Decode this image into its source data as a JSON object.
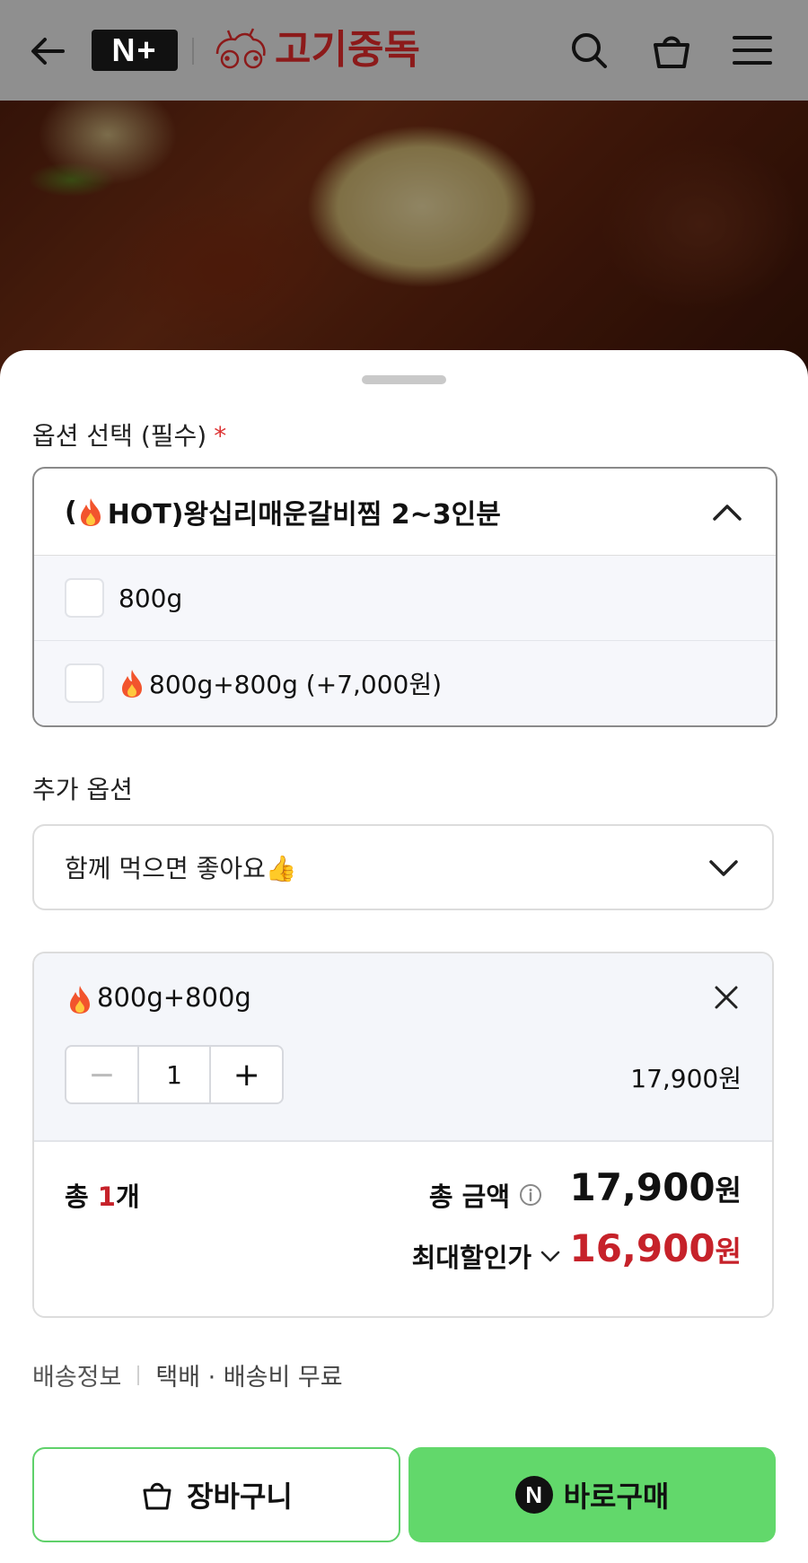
{
  "header": {
    "nplus_label": "N+",
    "brand_name": "고기중독",
    "icons": [
      "back-icon",
      "search-icon",
      "bag-icon",
      "menu-icon"
    ]
  },
  "options": {
    "required_label": "옵션 선택 (필수)",
    "required_mark": "*",
    "selected_title": "HOT)왕십리매운갈비찜 2~3인분",
    "selected_prefix": "(",
    "items": [
      {
        "label": "800g",
        "checked": false
      },
      {
        "label": "800g+800g (+7,000원)",
        "checked": false
      }
    ]
  },
  "extra": {
    "label": "추가 옵션",
    "placeholder": "함께 먹으면 좋아요👍"
  },
  "cart": {
    "item_name": "800g+800g",
    "quantity": "1",
    "minus_label": "−",
    "plus_label": "+",
    "line_price": "17,900원",
    "total_prefix": "총 ",
    "total_count": "1",
    "total_suffix": "개",
    "total_label": "총 금액",
    "total_amount": "17,900",
    "won": "원",
    "discount_label": "최대할인가",
    "discount_amount": "16,900"
  },
  "shipping": {
    "label": "배송정보",
    "value": "택배 · 배송비 무료"
  },
  "buttons": {
    "cart_label": "장바구니",
    "buy_label": "바로구매",
    "buy_badge": "N"
  },
  "colors": {
    "accent_red": "#c6222a",
    "buy_green": "#62d86b",
    "brand_red": "#8c1a1a"
  }
}
